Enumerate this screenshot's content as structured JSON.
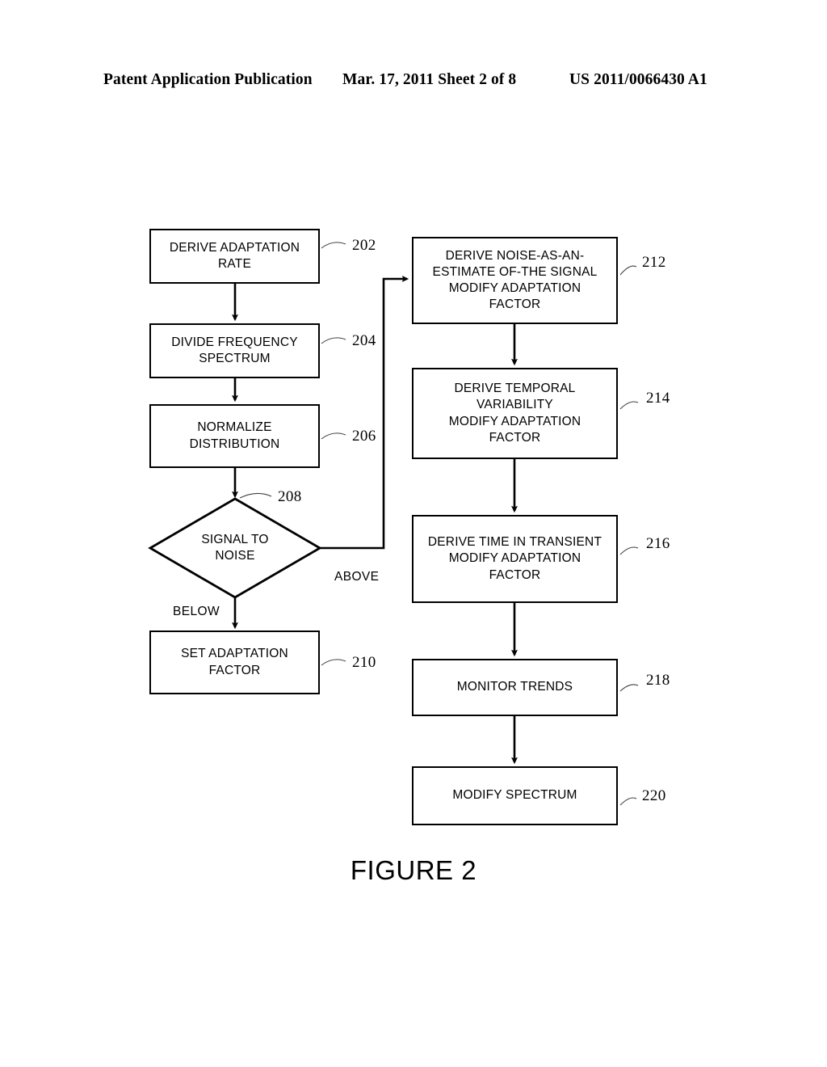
{
  "header": {
    "publication": "Patent Application Publication",
    "date_sheet": "Mar. 17, 2011  Sheet 2 of 8",
    "document_number": "US 2011/0066430 A1"
  },
  "figure": {
    "caption": "FIGURE 2",
    "colors": {
      "stroke": "#000000",
      "background": "#ffffff",
      "text": "#000000"
    },
    "nodes": [
      {
        "id": "202",
        "ref": "202",
        "shape": "process",
        "text": "DERIVE ADAPTATION\nRATE"
      },
      {
        "id": "204",
        "ref": "204",
        "shape": "process",
        "text": "DIVIDE FREQUENCY\nSPECTRUM"
      },
      {
        "id": "206",
        "ref": "206",
        "shape": "process",
        "text": "NORMALIZE\nDISTRIBUTION"
      },
      {
        "id": "208",
        "ref": "208",
        "shape": "decision",
        "text": "SIGNAL TO\nNOISE"
      },
      {
        "id": "210",
        "ref": "210",
        "shape": "process",
        "text": "SET ADAPTATION\nFACTOR"
      },
      {
        "id": "212",
        "ref": "212",
        "shape": "process",
        "text": "DERIVE NOISE-AS-AN-\nESTIMATE OF-THE SIGNAL\nMODIFY ADAPTATION\nFACTOR"
      },
      {
        "id": "214",
        "ref": "214",
        "shape": "process",
        "text": "DERIVE TEMPORAL\nVARIABILITY\nMODIFY ADAPTATION\nFACTOR"
      },
      {
        "id": "216",
        "ref": "216",
        "shape": "process",
        "text": "DERIVE TIME IN TRANSIENT\nMODIFY ADAPTATION\nFACTOR"
      },
      {
        "id": "218",
        "ref": "218",
        "shape": "process",
        "text": "MONITOR TRENDS"
      },
      {
        "id": "220",
        "ref": "220",
        "shape": "process",
        "text": "MODIFY SPECTRUM"
      }
    ],
    "branch_labels": {
      "above": "ABOVE",
      "below": "BELOW"
    },
    "connections": [
      {
        "from": "202",
        "to": "204",
        "label": ""
      },
      {
        "from": "204",
        "to": "206",
        "label": ""
      },
      {
        "from": "206",
        "to": "208",
        "label": ""
      },
      {
        "from": "208",
        "to": "210",
        "label": "BELOW"
      },
      {
        "from": "208",
        "to": "212",
        "label": "ABOVE"
      },
      {
        "from": "212",
        "to": "214",
        "label": ""
      },
      {
        "from": "214",
        "to": "216",
        "label": ""
      },
      {
        "from": "216",
        "to": "218",
        "label": ""
      },
      {
        "from": "218",
        "to": "220",
        "label": ""
      }
    ]
  }
}
